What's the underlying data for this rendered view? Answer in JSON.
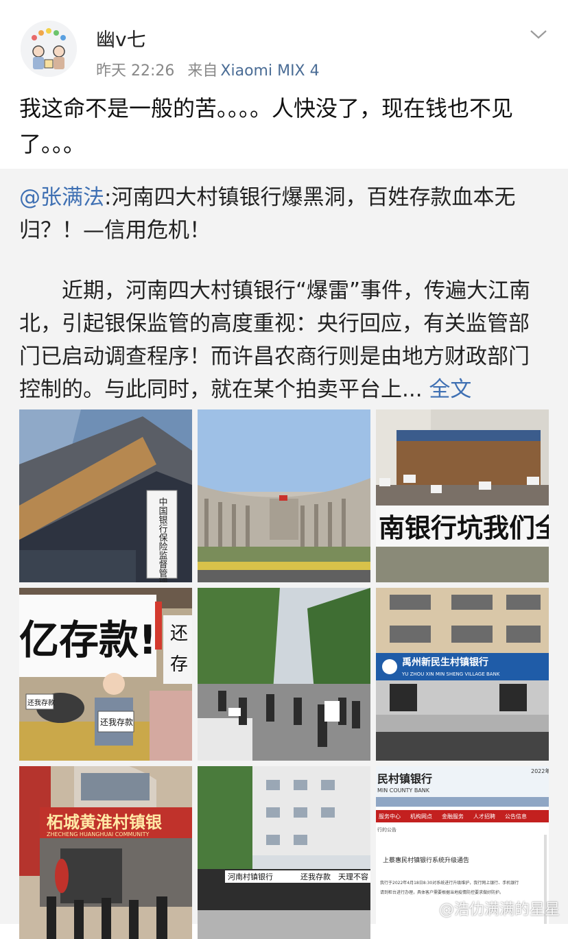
{
  "post": {
    "author": "幽v七",
    "time": "昨天 22:26",
    "source_prefix": "来自",
    "device": "Xiaomi MIX 4",
    "text": "我这命不是一般的苦。。。。人快没了，现在钱也不见了。。。"
  },
  "repost": {
    "mention": "@张满法",
    "headline": ":河南四大村镇银行爆黑洞，百姓存款血本无归？！—信用危机！",
    "body": "近期，河南四大村镇银行“爆雷”事件，传遍大江南北，引起银保监管的高度重视：央行回应，有关监管部门已启动调查程序！而许昌农商行则是由地方财政部门控制的。与此同时，就在某个拍卖平台上...",
    "full_text_link": "全文"
  },
  "images": [
    {
      "name": "cbirc-building-photo",
      "sign_text": "中国银行保险监督管理委员会"
    },
    {
      "name": "central-bank-building-photo"
    },
    {
      "name": "protest-at-office-photo",
      "banner_text": "南银行坑我们全国百万人"
    },
    {
      "name": "child-protest-photo",
      "banner_text": "亿存款!",
      "side_text": "还",
      "side_text2": "存",
      "placard_text": "还我存款",
      "small_placard_text": "还我存款"
    },
    {
      "name": "street-protest-photo"
    },
    {
      "name": "yuzhou-bank-photo",
      "bank_name": "禹州新民生村镇银行",
      "bank_name_en": "YU ZHOU XIN MIN SHENG VILLAGE BANK"
    },
    {
      "name": "zhecheng-bank-photo",
      "bank_name": "柘城黄淮村镇银",
      "bank_name_en": "ZHECHENG HUANGHUAI COMMUNITY"
    },
    {
      "name": "bank-protest-banners-photo",
      "banner_text": "河南村镇银行",
      "banner_text2": "还我存款",
      "banner_text3": "天理不容"
    },
    {
      "name": "bank-website-screenshot",
      "site_title": "民村镇银行",
      "site_subtitle": "MIN COUNTY BANK",
      "year": "2022年",
      "nav": [
        "服务中心",
        "机构网点",
        "金融服务",
        "人才招聘",
        "公告信息"
      ],
      "notice_title": "上蔡惠民村镇银行系统升级通告",
      "notice_line1": "我行于2022年4月18日8:30对系统进行升级维护，我行网上银行、手机银行",
      "notice_line2": "请到柜台进行办理，具体客户需要根据当地疫情防控要求做好防护。",
      "breadcrumb": "行的公告"
    }
  ],
  "watermark": "@浩仂满满的星星",
  "colors": {
    "link": "#3f70b3",
    "repost_bg": "#f3f3f3",
    "meta": "#888888"
  }
}
